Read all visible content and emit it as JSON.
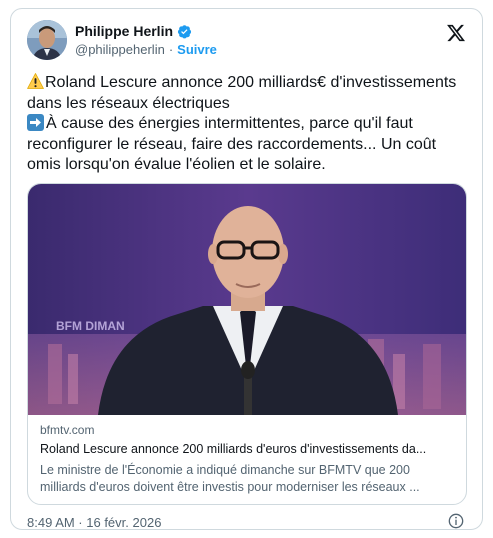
{
  "author": {
    "display_name": "Philippe Herlin",
    "handle": "@philippeherlin",
    "separator": "·",
    "follow_label": "Suivre"
  },
  "icons": {
    "verified": "verified-badge-icon",
    "brand": "x-logo-icon",
    "warning": "warning-emoji-icon",
    "arrow": "right-arrow-emoji-icon",
    "info": "info-icon"
  },
  "tweet": {
    "line1": "Roland Lescure annonce 200 milliards€ d'investissements dans les réseaux électriques",
    "line2": "À cause des énergies intermittentes, parce qu'il faut reconfigurer le réseau, faire des raccordements... Un coût omis lorsqu'on évalue l'éolien et le solaire."
  },
  "link_card": {
    "overlay_text": "BFM DIMAN",
    "domain": "bfmtv.com",
    "title": "Roland Lescure annonce 200 milliards d'euros d'investissements da...",
    "description": "Le ministre de l'Économie a indiqué dimanche sur BFMTV que 200 milliards d'euros doivent être investis pour moderniser les réseaux ..."
  },
  "footer": {
    "timestamp": "8:49 AM · 16 févr. 2026"
  },
  "colors": {
    "accent": "#1d9bf0",
    "text": "#0f1419",
    "muted": "#536471",
    "border": "#cfd9de"
  }
}
